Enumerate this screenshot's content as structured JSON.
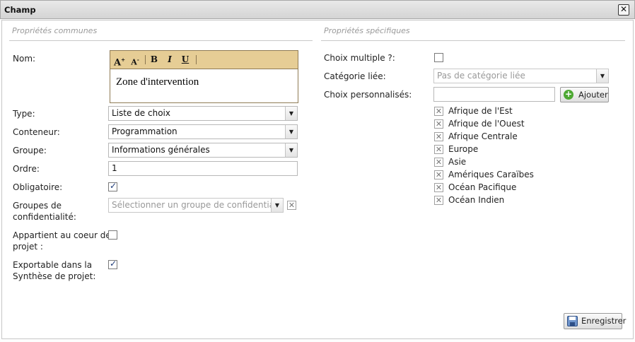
{
  "window": {
    "title": "Champ",
    "close_symbol": "✕"
  },
  "left": {
    "section_title": "Propriétés communes",
    "nom": {
      "label": "Nom:",
      "toolbar": {
        "grow": "A",
        "shrink": "A",
        "bold": "B",
        "italic": "I",
        "underline": "U"
      },
      "value": "Zone d'intervention"
    },
    "type": {
      "label": "Type:",
      "value": "Liste de choix"
    },
    "conteneur": {
      "label": "Conteneur:",
      "value": "Programmation"
    },
    "groupe": {
      "label": "Groupe:",
      "value": "Informations générales"
    },
    "ordre": {
      "label": "Ordre:",
      "value": "1"
    },
    "obligatoire": {
      "label": "Obligatoire:",
      "checked": true
    },
    "groupes_conf": {
      "label_line1": "Groupes de",
      "label_line2": "confidentialité:",
      "placeholder": "Sélectionner un groupe de confidentialité"
    },
    "coeur": {
      "label_line1": "Appartient au coeur de",
      "label_line2": "projet :",
      "checked": false
    },
    "exportable": {
      "label_line1": "Exportable dans la",
      "label_line2": "Synthèse de projet:",
      "checked": true
    }
  },
  "right": {
    "section_title": "Propriétés spécifiques",
    "choix_multiple": {
      "label": "Choix multiple ?:",
      "checked": false
    },
    "categorie": {
      "label": "Catégorie liée:",
      "value": "Pas de catégorie liée"
    },
    "choix_perso": {
      "label": "Choix personnalisés:",
      "input_value": "",
      "add_label": "Ajouter"
    },
    "choices": [
      "Afrique de l'Est",
      "Afrique de l'Ouest",
      "Afrique Centrale",
      "Europe",
      "Asie",
      "Amériques Caraïbes",
      "Océan Pacifique",
      "Océan Indien"
    ]
  },
  "footer": {
    "save_label": "Enregistrer"
  },
  "colors": {
    "toolbar_bg": "#e6cd95",
    "toolbar_border": "#8f7b55",
    "add_icon": "#4da832"
  },
  "icons": {
    "add": "plus-circle-icon",
    "save": "floppy-disk-icon",
    "remove": "x-box-icon"
  }
}
